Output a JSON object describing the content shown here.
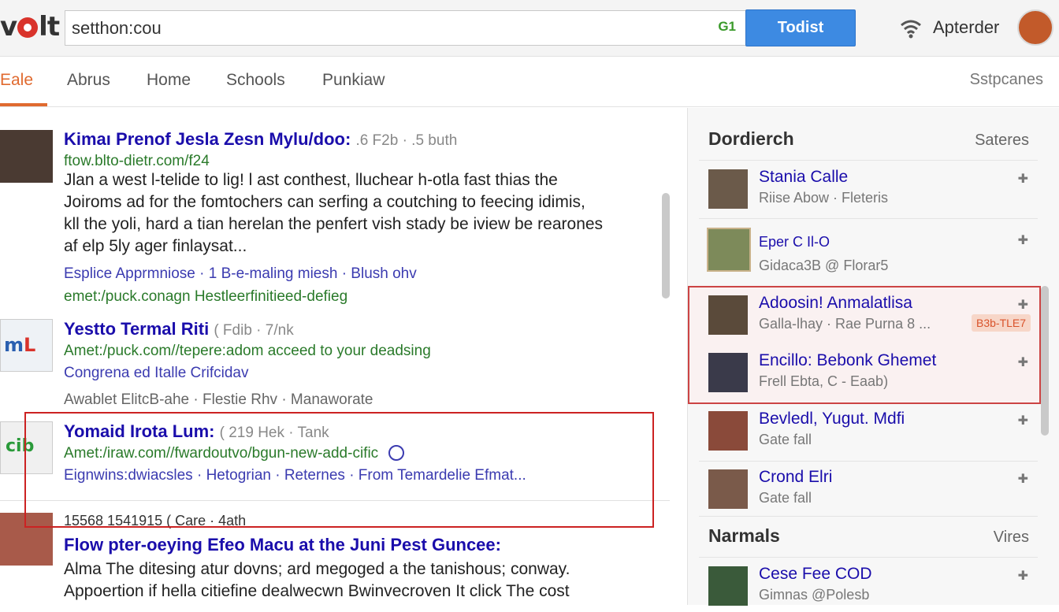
{
  "header": {
    "logo": "volt",
    "search_value": "setthon:cou",
    "search_badge": "G1",
    "search_button": "Todist",
    "user_name": "Apterder"
  },
  "tabs": {
    "items": [
      "Eale",
      "Abrus",
      "Home",
      "Schools",
      "Punkiaw"
    ],
    "right_link": "Sstpcanes"
  },
  "results": [
    {
      "title": "Kimaı Prenof Jesla Zesn Mylu/doo:",
      "meta": ".6 F2b · .5 buth",
      "url": "ftow.blto-dietr.com/f24",
      "snippet": [
        "Jlan a west l-telide to lig! l ast conthest, lluchear h-otla fast thias the",
        "Joiroms ad for the fomtochers can serfing a coutching to feecing idimis,",
        "kll the yoli, hard a tian herelan the penfert vish stady be iview be rearones",
        "af elp 5ly ager finlaysat..."
      ],
      "links": "Esplice Apprmniose  ·  1 B-e-maling miesh  ·  Blush ohv",
      "extra": "emet:/puck.conagn  Hestleerfinitieed-defieg"
    },
    {
      "title": "Yestto Termal Riti",
      "meta": "( Fdib · 7/nk",
      "url": "Amet:/puck.com//tepere:adom acceed to your deadsing",
      "links": "Congrena ed Italle Crifcidav",
      "grey": "Awablet ElitcB-ahe  ·  Flestie Rhv  ·  Manaworate"
    },
    {
      "title": "Yomaid Irota Lum:",
      "meta": "( 219 Hek · Tank",
      "url": "Amet:/iraw.com//fwardoutvo/bgun-new-add-cific",
      "grey": "Eignwins:dwiacsles  ·  Hetogrian  ·  Reternes  ·  From Temardelie Efmat..."
    },
    {
      "title": "Flow pter-oeying Efeo Macu at the Juni Pest Guncee:",
      "meta": "15568 1541915 ( Care · 4ath",
      "snippet": [
        "Alma The ditesing atur dovns; ard megoged a the tanishous; conway.",
        "Appoertion if hella citiefine dealwecwn Bwinvecroven It click The cost"
      ]
    }
  ],
  "sidebar": {
    "section1": {
      "title": "Dordierch",
      "more": "Sateres"
    },
    "section2": {
      "title": "Narmals",
      "more": "Vires"
    },
    "items": [
      {
        "name": "Stania Calle",
        "sub": "Riise Abow · Fleteris",
        "photo_color": "#6b5a4a"
      },
      {
        "name": "Eper C Il-O",
        "sub": "Gidaca3B @ Florar5",
        "photo_color": "#7d8a5a"
      },
      {
        "name": "Adoosin! Anmalatlisa",
        "sub": "Galla-lhay · Rae Purna 8 ...",
        "badge": "B3b-TLE7",
        "photo_color": "#5a4a3a"
      },
      {
        "name": "Encillo: Bebonk Ghemet",
        "sub": "Frell Ebta, C - Eaab)",
        "photo_color": "#3a3a4a"
      },
      {
        "name": "Bevledl, Yugut. Mdfi",
        "sub": "Gate fall",
        "photo_color": "#8a4a3a"
      },
      {
        "name": "Crond Elri",
        "sub": "Gate fall",
        "photo_color": "#7a5a4a"
      },
      {
        "name": "Cese Fee COD",
        "sub": "Gimnas @Polesb",
        "photo_color": "#3a5a3a"
      }
    ]
  }
}
